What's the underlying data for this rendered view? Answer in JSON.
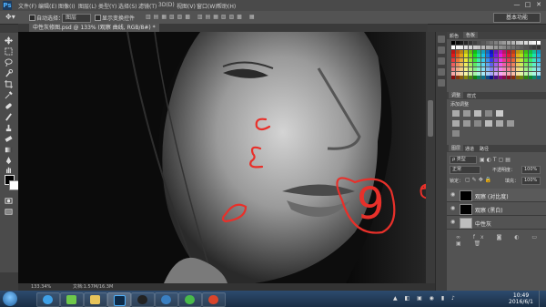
{
  "app": {
    "logo": "Ps",
    "menu": [
      "文件(F)",
      "编辑(E)",
      "图像(I)",
      "图层(L)",
      "类型(Y)",
      "选择(S)",
      "滤镜(T)",
      "3D(D)",
      "视图(V)",
      "窗口(W)",
      "帮助(H)"
    ],
    "window_controls": [
      "—",
      "□",
      "✕"
    ]
  },
  "options_bar": {
    "auto_select_label": "自动选择：",
    "auto_select_value": "图层",
    "show_transform_label": "显示变换控件",
    "workspace": "基本功能"
  },
  "document": {
    "tab_title": "中性灰修图.psd @ 133% (观察 曲线, RGB/8#) *",
    "status_zoom": "133.34%",
    "status_doc": "文档:1.57M/16.3M"
  },
  "panels": {
    "swatches_tabs": [
      "颜色",
      "色板"
    ],
    "adjustments_tabs": [
      "调整",
      "样式"
    ],
    "adjustments_title": "添加调整",
    "layers_tabs": [
      "图层",
      "通道",
      "路径"
    ],
    "kind_label": "ρ 类型",
    "blend_mode": "正常",
    "opacity_label": "不透明度：",
    "opacity_value": "100%",
    "lock_label": "锁定：",
    "fill_label": "填充：",
    "fill_value": "100%",
    "layers": [
      {
        "name": "观察 (对比度)",
        "thumb": "#000000"
      },
      {
        "name": "观察 (黑白)",
        "thumb": "#000000"
      },
      {
        "name": "中性灰",
        "thumb": "#bdbdbd"
      }
    ]
  },
  "annotations": {
    "number_label": "9",
    "color": "#e8302a"
  },
  "taskbar": {
    "time": "10:49",
    "date": "2016/6/1"
  },
  "colors": {
    "foreground": "#000000",
    "background": "#ffffff",
    "ps_blue": "#4fb3ff"
  }
}
